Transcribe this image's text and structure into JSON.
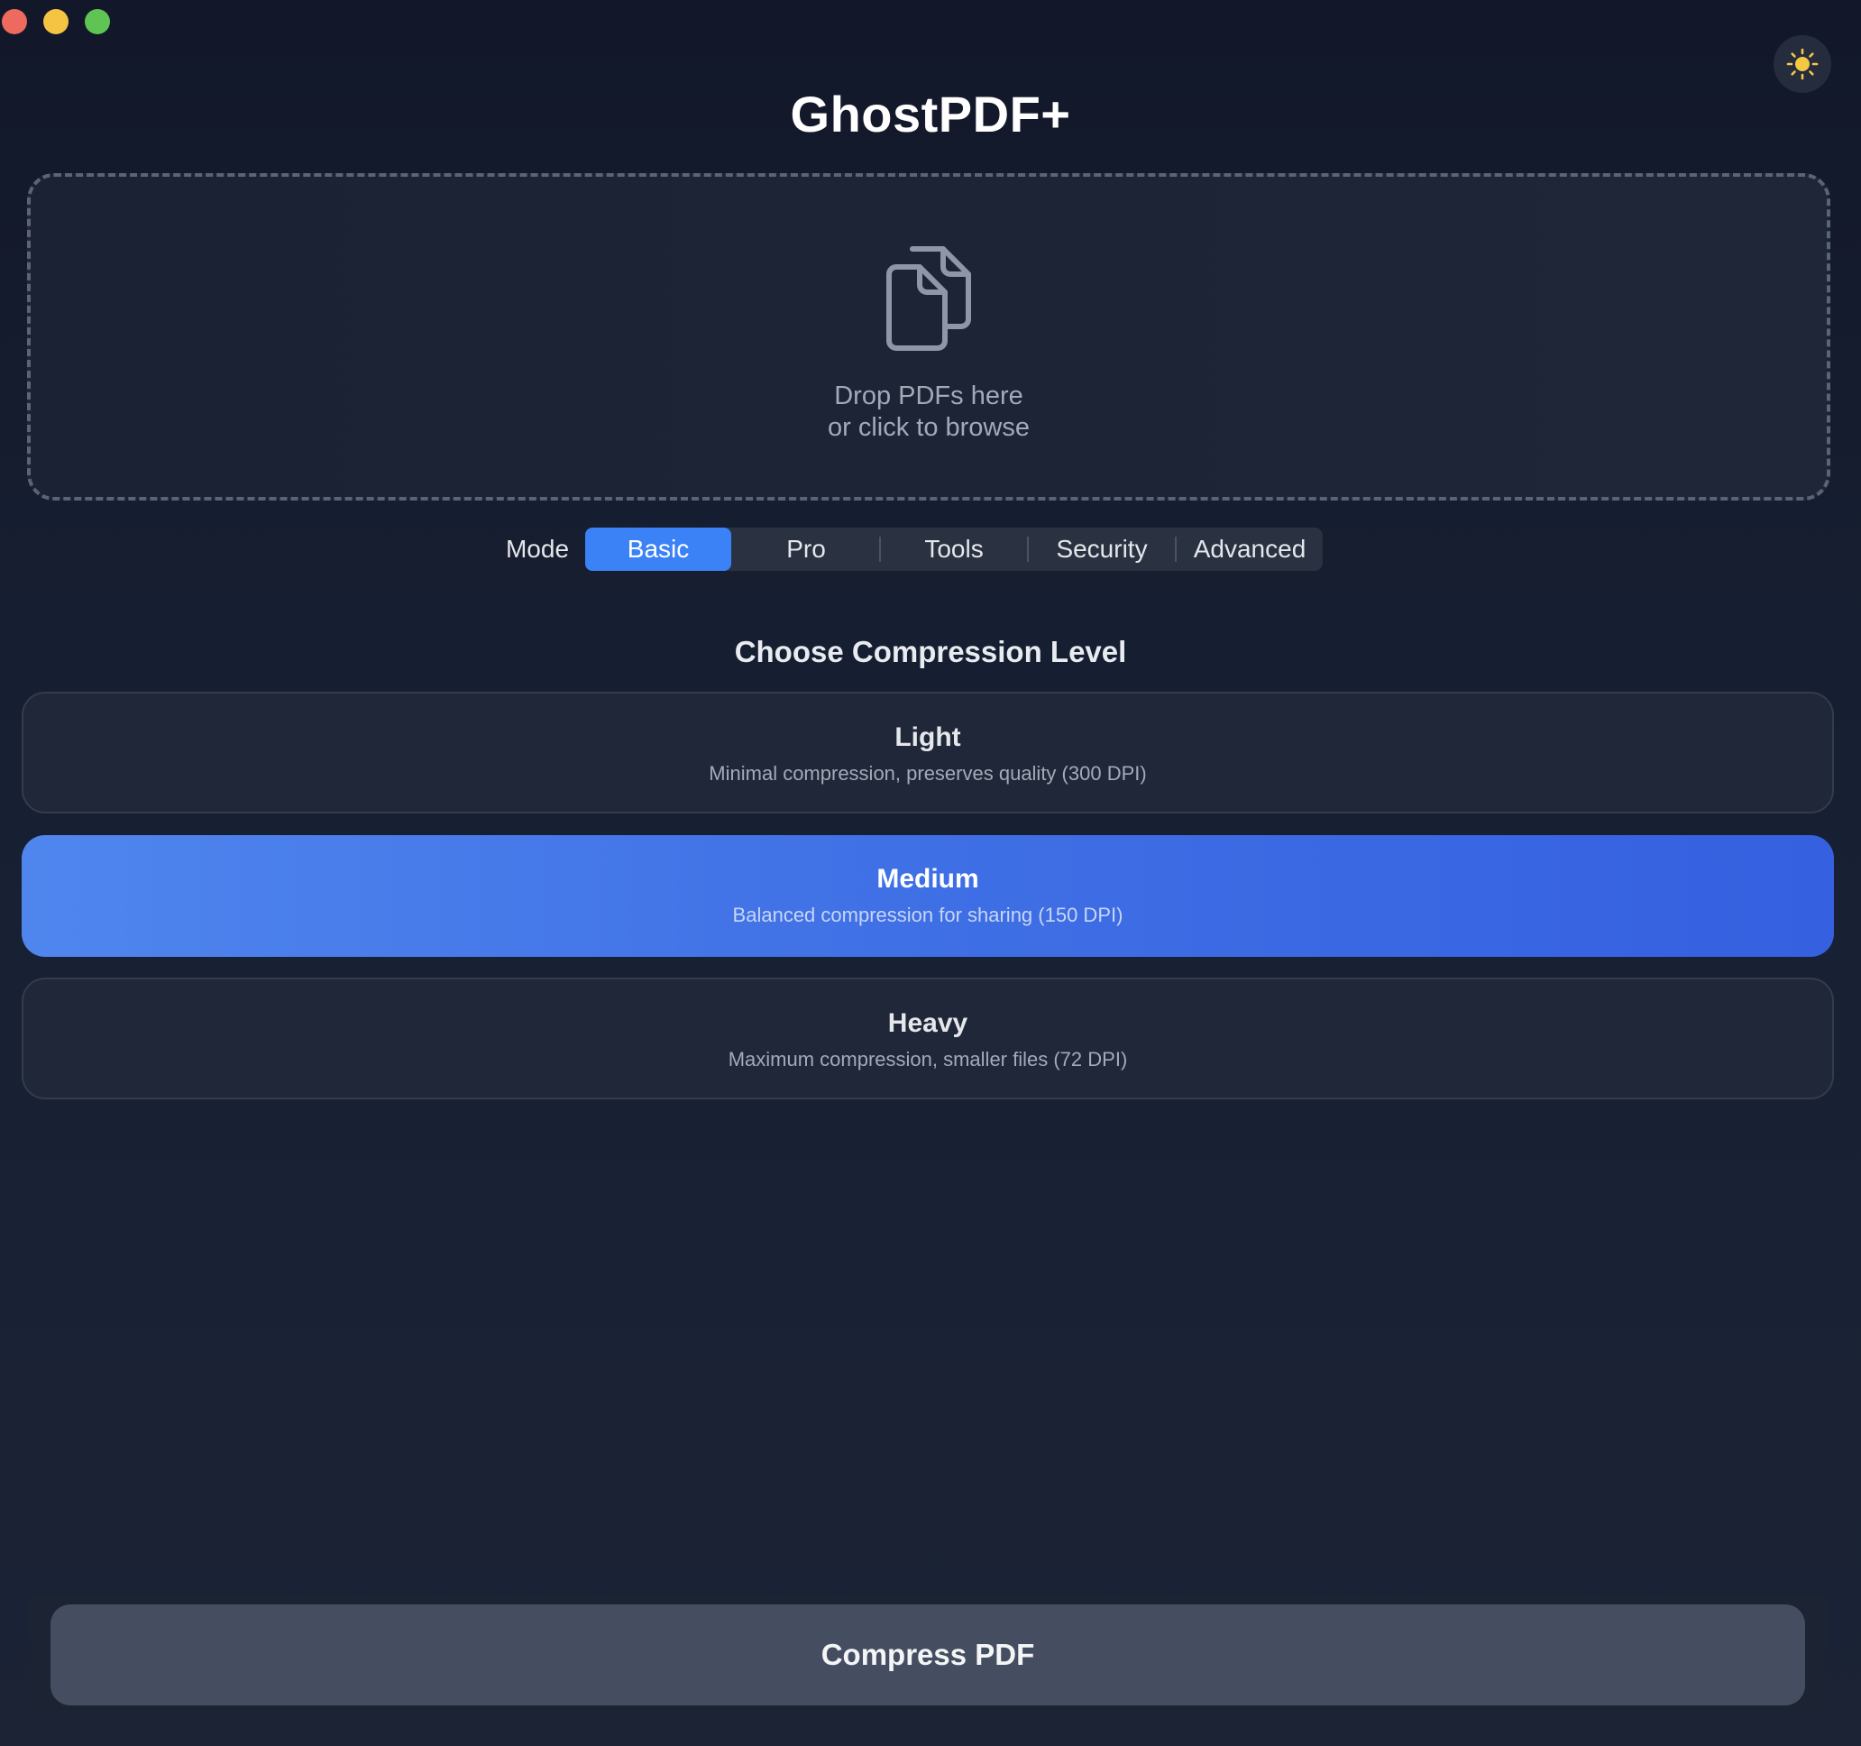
{
  "app": {
    "title": "GhostPDF+"
  },
  "window_controls": {
    "close_color": "#ee6a5e",
    "minimize_color": "#f5c442",
    "zoom_color": "#5fc454"
  },
  "theme_toggle": {
    "icon": "sun-icon",
    "color": "#f5c842"
  },
  "dropzone": {
    "icon": "documents-icon",
    "line1": "Drop PDFs here",
    "line2": "or click to browse"
  },
  "mode": {
    "label": "Mode",
    "tabs": [
      {
        "label": "Basic",
        "active": true
      },
      {
        "label": "Pro",
        "active": false
      },
      {
        "label": "Tools",
        "active": false
      },
      {
        "label": "Security",
        "active": false
      },
      {
        "label": "Advanced",
        "active": false
      }
    ],
    "accent": "#3b82f6"
  },
  "compression": {
    "heading": "Choose Compression Level",
    "options": [
      {
        "title": "Light",
        "description": "Minimal compression, preserves quality (300 DPI)",
        "selected": false
      },
      {
        "title": "Medium",
        "description": "Balanced compression for sharing (150 DPI)",
        "selected": true
      },
      {
        "title": "Heavy",
        "description": "Maximum compression, smaller files (72 DPI)",
        "selected": false
      }
    ]
  },
  "action": {
    "button_label": "Compress PDF"
  }
}
